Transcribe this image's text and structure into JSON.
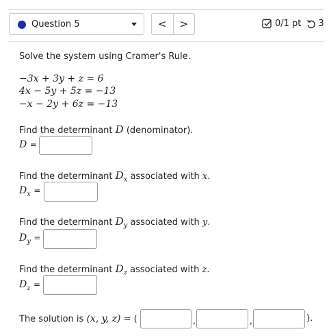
{
  "question_selector": {
    "label": "Question 5"
  },
  "nav": {
    "prev": "<",
    "next": ">"
  },
  "score": {
    "points": "0/1 pt",
    "attempts": "3"
  },
  "problem": {
    "prompt": "Solve the system using Cramer's Rule.",
    "equations": [
      "−3x + 3y + z = 6",
      "4x − 5y + 5z = −13",
      "−x − 2y + 6z = −13"
    ]
  },
  "parts": {
    "d": {
      "text_before": "Find the determinant ",
      "symbol": "D",
      "text_after": " (denominator).",
      "answer_label": "D",
      "eq": "=",
      "value": ""
    },
    "dx": {
      "text_before": "Find the determinant ",
      "symbol": "D",
      "sub": "x",
      "text_after": " associated with ",
      "var": "x",
      "end": ".",
      "answer_label": "D",
      "eq": "=",
      "value": ""
    },
    "dy": {
      "text_before": "Find the determinant ",
      "symbol": "D",
      "sub": "y",
      "text_after": " associated with ",
      "var": "y",
      "end": ".",
      "answer_label": "D",
      "eq": "=",
      "value": ""
    },
    "dz": {
      "text_before": "Find the determinant ",
      "symbol": "D",
      "sub": "z",
      "text_after": " associated with ",
      "var": "z",
      "end": ".",
      "answer_label": "D",
      "eq": "=",
      "value": ""
    }
  },
  "solution": {
    "text": "The solution is ",
    "tuple": "(x, y, z)",
    "eq": " = (",
    "comma": ",",
    "close": ").",
    "values": [
      "",
      "",
      ""
    ]
  },
  "colors": {
    "question_dot": "#1b2fa8",
    "border": "#c9c9c9"
  },
  "icons": {
    "score_check": "checkbox-check-icon",
    "retry": "retry-arrow-icon",
    "dropdown": "caret-down-icon"
  }
}
